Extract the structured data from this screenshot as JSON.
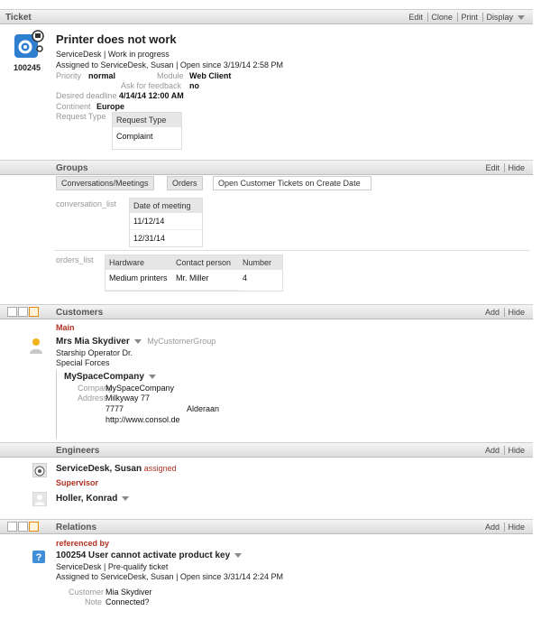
{
  "ticket": {
    "section_title": "Ticket",
    "actions": [
      "Edit",
      "Clone",
      "Print",
      "Display"
    ],
    "id": "100245",
    "title": "Printer does not work",
    "queue_status": "ServiceDesk | Work in progress",
    "assigned": "Assigned to ServiceDesk, Susan | Open since 3/19/14 2:58 PM",
    "priority_label": "Priority",
    "priority_value": "normal",
    "module_label": "Module",
    "module_value": "Web Client",
    "feedback_label": "Ask for feedback",
    "feedback_value": "no",
    "deadline_label": "Desired deadline",
    "deadline_value": "4/14/14 12:00 AM",
    "continent_label": "Continent",
    "continent_value": "Europe",
    "request_type_label": "Request Type",
    "request_type_header": "Request Type",
    "request_type_value": "Complaint"
  },
  "groups": {
    "section_title": "Groups",
    "actions": [
      "Edit",
      "Hide"
    ],
    "tabs": [
      "Conversations/Meetings",
      "Orders",
      "Open Customer Tickets on Create Date"
    ],
    "conversation_label": "conversation_list",
    "conversation_header": "Date of meeting",
    "conversation_rows": [
      "11/12/14",
      "12/31/14"
    ],
    "orders_label": "orders_list",
    "orders_headers": [
      "Hardware",
      "Contact person",
      "Number"
    ],
    "orders_row": [
      "Medium printers",
      "Mr. Miller",
      "4"
    ]
  },
  "customers": {
    "section_title": "Customers",
    "actions": [
      "Add",
      "Hide"
    ],
    "role": "Main",
    "name": "Mrs Mia Skydiver",
    "group": "MyCustomerGroup",
    "line1": "Starship Operator Dr.",
    "line2": "Special Forces",
    "company_name": "MySpaceCompany",
    "company_label": "Company",
    "company_value": "MySpaceCompany",
    "address_label": "Address",
    "address_street": "Milkyway 77",
    "address_zip": "7777",
    "address_city": "Alderaan",
    "address_web": "http://www.consol.de"
  },
  "engineers": {
    "section_title": "Engineers",
    "actions": [
      "Add",
      "Hide"
    ],
    "engineer_name": "ServiceDesk, Susan",
    "engineer_status": "assigned",
    "supervisor_role": "Supervisor",
    "supervisor_name": "Holler, Konrad"
  },
  "relations": {
    "section_title": "Relations",
    "actions": [
      "Add",
      "Hide"
    ],
    "type": "referenced by",
    "ref_id": "100254",
    "ref_title": "User cannot activate product key",
    "ref_status": "ServiceDesk | Pre-qualify ticket",
    "ref_assigned": "Assigned to ServiceDesk, Susan | Open since 3/31/14 2:24 PM",
    "customer_label": "Customer",
    "customer_value": "Mia Skydiver",
    "note_label": "Note",
    "note_value": "Connected?"
  }
}
